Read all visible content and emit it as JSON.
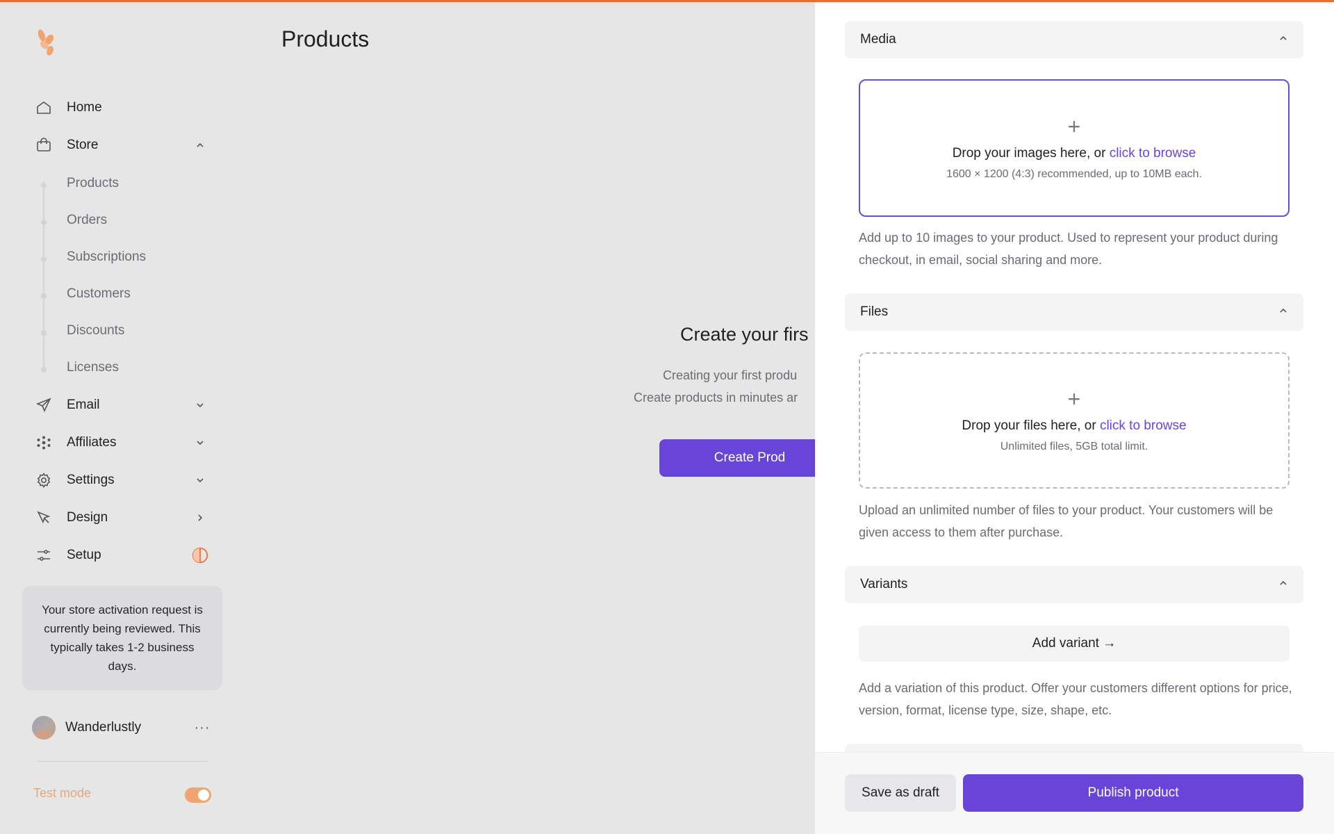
{
  "colors": {
    "accent": "#6845d8",
    "topline": "#f06a35",
    "brand": "#f0a46f"
  },
  "sidebar": {
    "logo_icon": "flower-logo-icon",
    "nav": [
      {
        "label": "Home",
        "icon": "home-icon"
      },
      {
        "label": "Store",
        "icon": "shopping-bag-icon",
        "chevron": "chevron-up-icon"
      },
      {
        "label": "Email",
        "icon": "send-icon",
        "chevron": "chevron-down-icon"
      },
      {
        "label": "Affiliates",
        "icon": "network-icon",
        "chevron": "chevron-down-icon"
      },
      {
        "label": "Settings",
        "icon": "gear-icon",
        "chevron": "chevron-down-icon"
      },
      {
        "label": "Design",
        "icon": "cursor-icon",
        "chevron": "chevron-right-icon"
      },
      {
        "label": "Setup",
        "icon": "sliders-icon",
        "status_icon": "progress-circle-icon"
      }
    ],
    "store_sub": [
      "Products",
      "Orders",
      "Subscriptions",
      "Customers",
      "Discounts",
      "Licenses"
    ],
    "notice": "Your store activation request is currently being reviewed. This typically takes 1-2 business days.",
    "user": {
      "name": "Wanderlustly",
      "more": "···"
    },
    "test_mode": {
      "label": "Test mode",
      "enabled": true
    }
  },
  "main": {
    "title": "Products",
    "empty": {
      "title": "Create your firs",
      "line1": "Creating your first produ",
      "line2": "Create products in minutes ar",
      "button": "Create Prod"
    }
  },
  "drawer": {
    "media": {
      "title": "Media",
      "drop_text": "Drop your images here, or ",
      "browse": "click to browse",
      "hint": "1600 × 1200 (4:3) recommended, up to 10MB each.",
      "desc": "Add up to 10 images to your product. Used to represent your product during checkout, in email, social sharing and more."
    },
    "files": {
      "title": "Files",
      "drop_text": "Drop your files here, or ",
      "browse": "click to browse",
      "hint": "Unlimited files, 5GB total limit.",
      "desc": "Upload an unlimited number of files to your product. Your customers will be given access to them after purchase."
    },
    "variants": {
      "title": "Variants",
      "button": "Add variant →",
      "desc": "Add a variation of this product. Offer your customers different options for price, version, format, license type, size, shape, etc."
    },
    "footer": {
      "draft": "Save as draft",
      "publish": "Publish product"
    }
  }
}
